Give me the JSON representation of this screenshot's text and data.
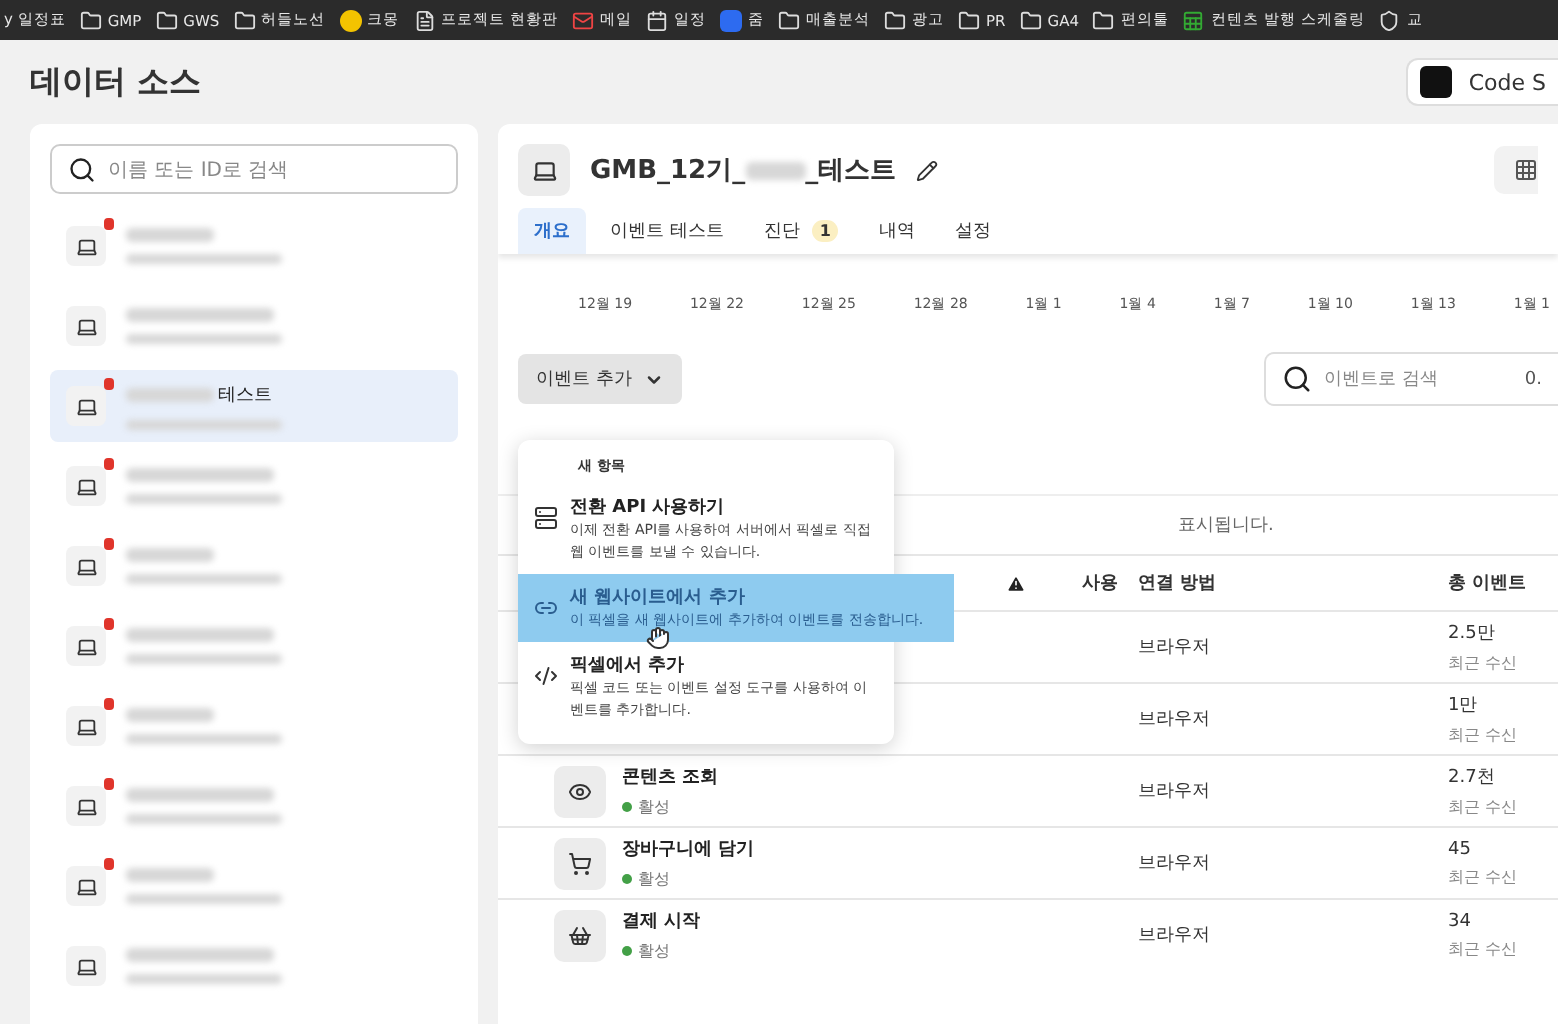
{
  "bookmarks": [
    {
      "label": "y 일정표",
      "kind": "none"
    },
    {
      "label": "GMP",
      "kind": "folder"
    },
    {
      "label": "GWS",
      "kind": "folder"
    },
    {
      "label": "허들노선",
      "kind": "folder"
    },
    {
      "label": "크몽",
      "kind": "badge"
    },
    {
      "label": "프로젝트 현황판",
      "kind": "doc"
    },
    {
      "label": "메일",
      "kind": "mail"
    },
    {
      "label": "일정",
      "kind": "calendar"
    },
    {
      "label": "줌",
      "kind": "zoom"
    },
    {
      "label": "매출분석",
      "kind": "folder"
    },
    {
      "label": "광고",
      "kind": "folder"
    },
    {
      "label": "PR",
      "kind": "folder"
    },
    {
      "label": "GA4",
      "kind": "folder"
    },
    {
      "label": "편의툴",
      "kind": "folder"
    },
    {
      "label": "컨텐츠 발행 스케줄링",
      "kind": "sheet"
    },
    {
      "label": "교",
      "kind": "shield"
    }
  ],
  "page_title": "데이터 소스",
  "code_button": "Code S",
  "sidebar": {
    "search_placeholder": "이름 또는 ID로 검색",
    "items": [
      {
        "alert": true,
        "selected": false
      },
      {
        "alert": false,
        "selected": false
      },
      {
        "alert": true,
        "selected": true,
        "visible_name": "테스트"
      },
      {
        "alert": true,
        "selected": false
      },
      {
        "alert": true,
        "selected": false
      },
      {
        "alert": true,
        "selected": false
      },
      {
        "alert": true,
        "selected": false
      },
      {
        "alert": true,
        "selected": false
      },
      {
        "alert": true,
        "selected": false
      },
      {
        "alert": false,
        "selected": false
      }
    ]
  },
  "source": {
    "title_start": "GMB_12기_",
    "title_end": "_테스트",
    "tabs": [
      {
        "label": "개요",
        "selected": true
      },
      {
        "label": "이벤트 테스트",
        "selected": false
      },
      {
        "label": "진단",
        "selected": false,
        "badge": "1"
      },
      {
        "label": "내역",
        "selected": false
      },
      {
        "label": "설정",
        "selected": false
      }
    ]
  },
  "timeline_dates": [
    "12월 19",
    "12월 22",
    "12월 25",
    "12월 28",
    "1월 1",
    "1월 4",
    "1월 7",
    "1월 10",
    "1월 13",
    "1월 1"
  ],
  "add_event_button": "이벤트 추가",
  "event_search": {
    "placeholder": "이벤트로 검색",
    "count": "0."
  },
  "notice": "표시됩니다.",
  "table": {
    "columns": [
      "사용",
      "연결 방법",
      "총 이벤트"
    ],
    "rows": [
      {
        "kind": "covered",
        "method": "브라우저",
        "total": "2.5만",
        "sub": "최근 수신"
      },
      {
        "kind": "covered",
        "method": "브라우저",
        "total": "1만",
        "sub": "최근 수신"
      },
      {
        "kind": "view",
        "name": "콘텐츠 조회",
        "status": "활성",
        "method": "브라우저",
        "total": "2.7천",
        "sub": "최근 수신"
      },
      {
        "kind": "cart",
        "name": "장바구니에 담기",
        "status": "활성",
        "method": "브라우저",
        "total": "45",
        "sub": "최근 수신"
      },
      {
        "kind": "checkout",
        "name": "결제 시작",
        "status": "활성",
        "method": "브라우저",
        "total": "34",
        "sub": "최근 수신"
      }
    ]
  },
  "menu": {
    "heading": "새 항목",
    "items": [
      {
        "title": "전환 API 사용하기",
        "desc": "이제 전환 API를 사용하여 서버에서 픽셀로 직접 웹 이벤트를 보낼 수 있습니다.",
        "kind": "api",
        "selected": false
      },
      {
        "title": "새 웹사이트에서 추가",
        "desc": "이 픽셀을 새 웹사이트에 추가하여 이벤트를 전송합니다.",
        "kind": "website",
        "selected": true
      },
      {
        "title": "픽셀에서 추가",
        "desc": "픽셀 코드 또는 이벤트 설정 도구를 사용하여 이벤트를 추가합니다.",
        "kind": "pixel",
        "selected": false
      }
    ]
  }
}
